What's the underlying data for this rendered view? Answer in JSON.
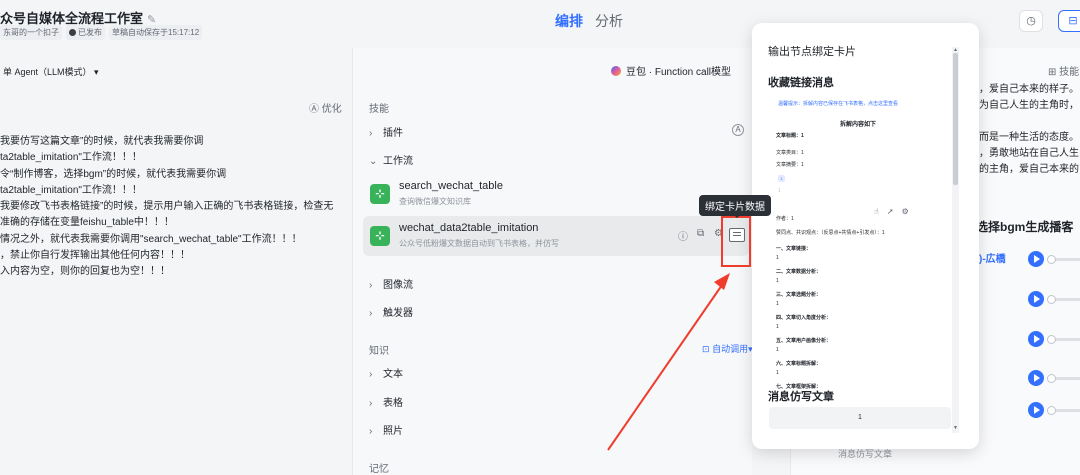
{
  "header": {
    "title": "众号自媒体全流程工作室",
    "tags": [
      "东哥的一个扣子",
      "已发布",
      "草稿自动保存于15:17:12"
    ],
    "tabs": [
      "编排",
      "分析"
    ],
    "active_tab": "编排"
  },
  "left": {
    "agent_mode": "单 Agent（LLM模式）",
    "optimize": "优化",
    "prompt_lines": [
      "我要仿写这篇文章”的时候，就代表我需要你调",
      "ta2table_imitation\"工作流！！！",
      "令“制作博客，选择bgm”的时候，就代表我需要你调",
      "ta2table_imitation\"工作流！！！",
      "我要修改飞书表格链接”的时候，提示用户输入正确的飞书表格链接，检查无",
      "准确的存储在变量feishu_table中！！！",
      "情况之外，就代表我需要你调用\"search_wechat_table\"工作流！！！",
      "，禁止你自行发挥输出其他任何内容！！！",
      "入内容为空，则你的回复也为空！！！"
    ]
  },
  "middle": {
    "model": "豆包 · Function call模型",
    "skills_title": "技能",
    "plugins": "插件",
    "workflows": "工作流",
    "workflow_items": [
      {
        "name": "search_wechat_table",
        "desc": "查询微信爆文知识库"
      },
      {
        "name": "wechat_data2table_imitation",
        "desc": "公众号低粉爆文数据自动到飞书表格，并仿写"
      }
    ],
    "image_flow": "图像流",
    "trigger": "触发器",
    "knowledge_title": "知识",
    "auto_call": "自动调用",
    "knowledge_items": [
      "文本",
      "表格",
      "照片"
    ],
    "memory_title": "记忆"
  },
  "tooltip": "绑定卡片数据",
  "popup": {
    "title": "输出节点绑定卡片",
    "section1": "收藏链接消息",
    "section2": "消息仿写文章",
    "card": {
      "hint": "温馨提示：拆解内容已保存在飞书表格，点击这里查看",
      "heading": "拆解内容如下",
      "title_line": "文章标题：1",
      "lines_a": [
        "文章类目：1",
        "文章摘要：1"
      ],
      "author": "作者：1",
      "meta": "赞同点、共识观点：（反思点+共情点+引发点）：1",
      "one": "1",
      "sections": [
        "一、文章链接：",
        "二、文章数据分析：",
        "三、文章选题分析：",
        "四、文章切入角度分析：",
        "五、文章用户画像分析：",
        "六、文章标题拆解：",
        "七、文章框架拆解："
      ]
    },
    "ghost_value": "1"
  },
  "right": {
    "skills": "技能",
    "story_lines": [
      "众，爱自己本来的样子。",
      "成为自己人生的主角时，",
      "",
      "，而是一种生活的态度。",
      "样，勇敢地站在自己人生",
      "生的主角，爱自己本来的"
    ],
    "bgm_title": "选择bgm生成播客",
    "bgm_first": "字)-広橋",
    "bottom_hint": "消息仿写文章"
  }
}
